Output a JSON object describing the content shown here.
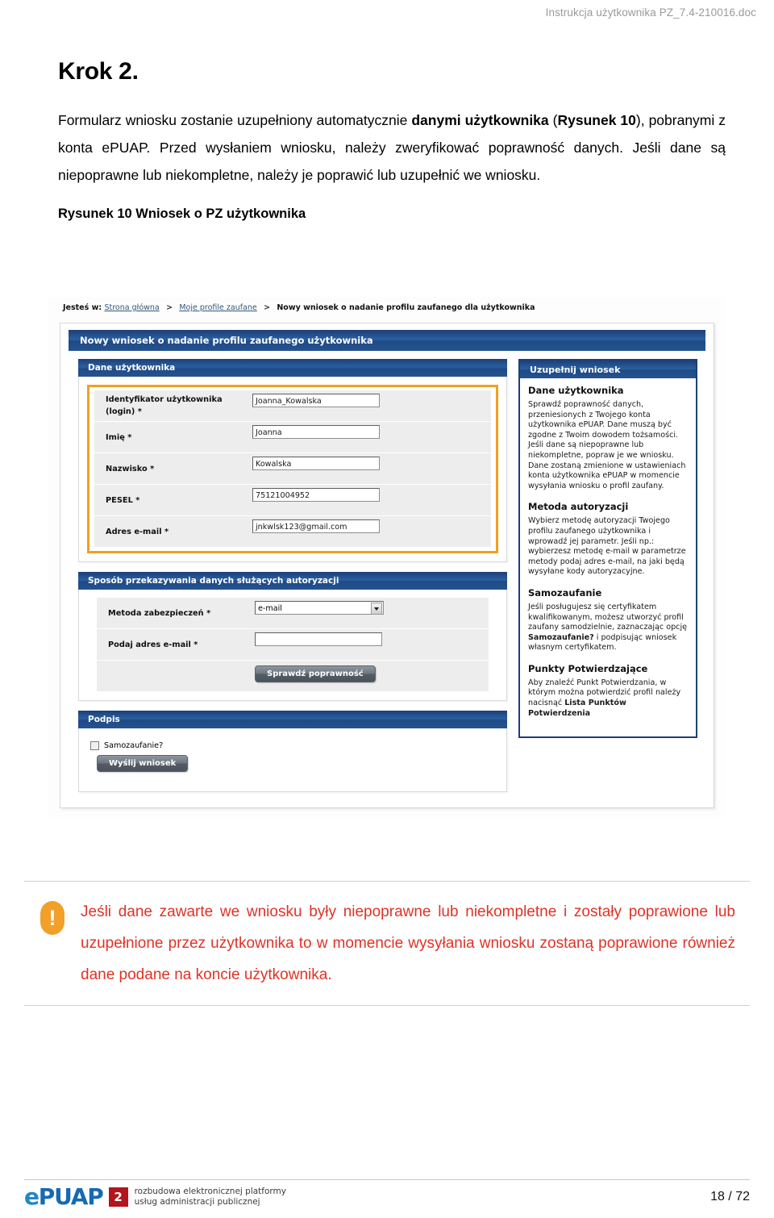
{
  "doc": {
    "header_right": "Instrukcja użytkownika PZ_7.4-210016.doc",
    "page_number": "18 / 72"
  },
  "content": {
    "step_title": "Krok 2.",
    "paragraph_1_part1": "Formularz wniosku zostanie uzupełniony automatycznie ",
    "paragraph_1_bold1": "danymi użytkownika",
    "paragraph_1_part2": " (",
    "paragraph_1_bold2": "Rysunek 10",
    "paragraph_1_part3": "), pobranymi z konta ePUAP. Przed wysłaniem wniosku, należy zweryfikować poprawność danych. Jeśli dane są niepoprawne lub niekompletne, należy je poprawić lub uzupełnić we wniosku.",
    "figure_caption": "Rysunek 10 Wniosek o PZ użytkownika"
  },
  "screenshot": {
    "breadcrumb": {
      "lead": "Jesteś w:",
      "link_1": "Strona główna",
      "separator": ">",
      "link_2": "Moje profile zaufane",
      "current": "Nowy wniosek o nadanie profilu zaufanego dla użytkownika"
    },
    "portlet_title": "Nowy wniosek o nadanie profilu zaufanego użytkownika",
    "sections": {
      "user_data": {
        "title": "Dane użytkownika",
        "fields": [
          {
            "label": "Identyfikator użytkownika (login) *",
            "value": "Joanna_Kowalska"
          },
          {
            "label": "Imię *",
            "value": "Joanna"
          },
          {
            "label": "Nazwisko *",
            "value": "Kowalska"
          },
          {
            "label": "PESEL *",
            "value": "75121004952"
          },
          {
            "label": "Adres e-mail *",
            "value": "jnkwlsk123@gmail.com"
          }
        ]
      },
      "auth_method": {
        "title": "Sposób przekazywania danych służących autoryzacji",
        "field_method_label": "Metoda zabezpieczeń *",
        "field_method_value": "e-mail",
        "field_email_label": "Podaj adres e-mail *",
        "field_email_value": "",
        "verify_button": "Sprawdź poprawność"
      },
      "signature": {
        "title": "Podpis",
        "checkbox_label": "Samozaufanie?",
        "submit_button": "Wyślij wniosek"
      }
    },
    "help_panel": {
      "title": "Uzupełnij wniosek",
      "blocks": [
        {
          "heading": "Dane użytkownika",
          "text": "Sprawdź poprawność danych, przeniesionych z Twojego konta użytkownika ePUAP. Dane muszą być zgodne z Twoim dowodem tożsamości. Jeśli dane są niepoprawne lub niekompletne, popraw je we wniosku. Dane zostaną zmienione w ustawieniach konta użytkownika ePUAP w momencie wysyłania wniosku o profil zaufany."
        },
        {
          "heading": "Metoda autoryzacji",
          "text": "Wybierz metodę autoryzacji Twojego profilu zaufanego użytkownika i wprowadź jej parametr. Jeśli np.: wybierzesz metodę e-mail w parametrze metody podaj adres e-mail, na jaki będą wysyłane kody autoryzacyjne."
        },
        {
          "heading": "Samozaufanie",
          "text_part1": "Jeśli posługujesz się certyfikatem kwalifikowanym, możesz utworzyć profil zaufany samodzielnie, zaznaczając opcję ",
          "text_bold": "Samozaufanie?",
          "text_part2": " i podpisując wniosek własnym certyfikatem."
        },
        {
          "heading": "Punkty Potwierdzające",
          "text_part1": "Aby znaleźć Punkt Potwierdzania, w którym można potwierdzić profil należy nacisnąć ",
          "text_bold": "Lista Punktów Potwierdzenia"
        }
      ]
    }
  },
  "callout": {
    "icon": "exclamation-icon",
    "text": "Jeśli dane zawarte we wniosku były niepoprawne lub niekompletne i zostały poprawione lub uzupełnione przez użytkownika to w momencie wysyłania wniosku zostaną poprawione również dane podane na koncie użytkownika."
  },
  "footer": {
    "logo_e": "e",
    "logo_rest": "PUAP",
    "logo_badge": "2",
    "tagline_line1": "rozbudowa elektronicznej platformy",
    "tagline_line2": "usług administracji publicznej"
  },
  "colors": {
    "brand_blue": "#1d3f77",
    "accent_orange": "#f2a020",
    "warning_red": "#e03226",
    "logo_blue": "#1669b3",
    "logo_badge_red": "#b3151d"
  }
}
